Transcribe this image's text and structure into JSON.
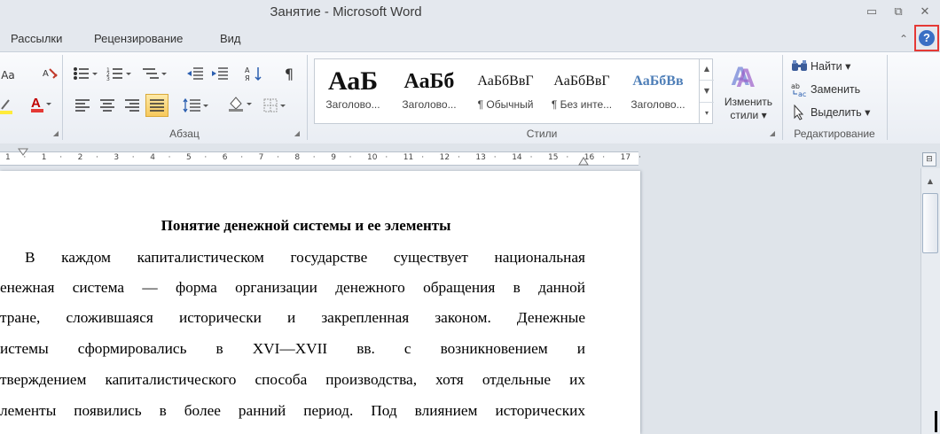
{
  "window": {
    "title": "Занятие  -  Microsoft Word",
    "minimize_icon": "▭",
    "restore_icon": "⧉",
    "close_icon": "✕"
  },
  "menu": {
    "tabs": [
      "Рассылки",
      "Рецензирование",
      "Вид"
    ],
    "collapse_icon": "⌃",
    "help_icon": "?"
  },
  "ribbon": {
    "paragraph_group_label": "Абзац",
    "font_group_fragment": "Aa",
    "styles_group_label": "Стили",
    "editing_group_label": "Редактирование",
    "styles": [
      {
        "sample": "АаБ",
        "name": "Заголово..."
      },
      {
        "sample": "АаБб",
        "name": "Заголово..."
      },
      {
        "sample": "АаБбВвГ",
        "name": "¶ Обычный"
      },
      {
        "sample": "АаБбВвГ",
        "name": "¶ Без инте..."
      },
      {
        "sample": "АаБбВв",
        "name": "Заголово..."
      }
    ],
    "change_styles_line1": "Изменить",
    "change_styles_line2": "стили ▾",
    "find_label": "Найти ▾",
    "replace_label": "Заменить",
    "select_label": "Выделить ▾",
    "accent_blue": "#3a6fc4",
    "accent_red": "#e53935"
  },
  "ruler": {
    "ticks": [
      "1",
      "·",
      "1",
      "·",
      "2",
      "·",
      "3",
      "·",
      "4",
      "·",
      "5",
      "·",
      "6",
      "·",
      "7",
      "·",
      "8",
      "·",
      "9",
      "·",
      "10",
      "·",
      "11",
      "·",
      "12",
      "·",
      "13",
      "·",
      "14",
      "·",
      "15",
      "·",
      "16",
      "·",
      "17",
      "·"
    ]
  },
  "document": {
    "heading": "Понятие денежной системы и ее элементы",
    "lines": [
      "В каждом капиталистическом государстве существует национальная",
      "енежная система — форма организации денежного обращения в данной",
      "тране, сложившаяся исторически и закрепленная законом. Денежные",
      "истемы сформировались в XVI—XVII вв. с возникновением и",
      "тверждением капиталистического способа производства, хотя отдельные их",
      "лементы появились в более ранний период. Под влиянием исторических"
    ]
  }
}
